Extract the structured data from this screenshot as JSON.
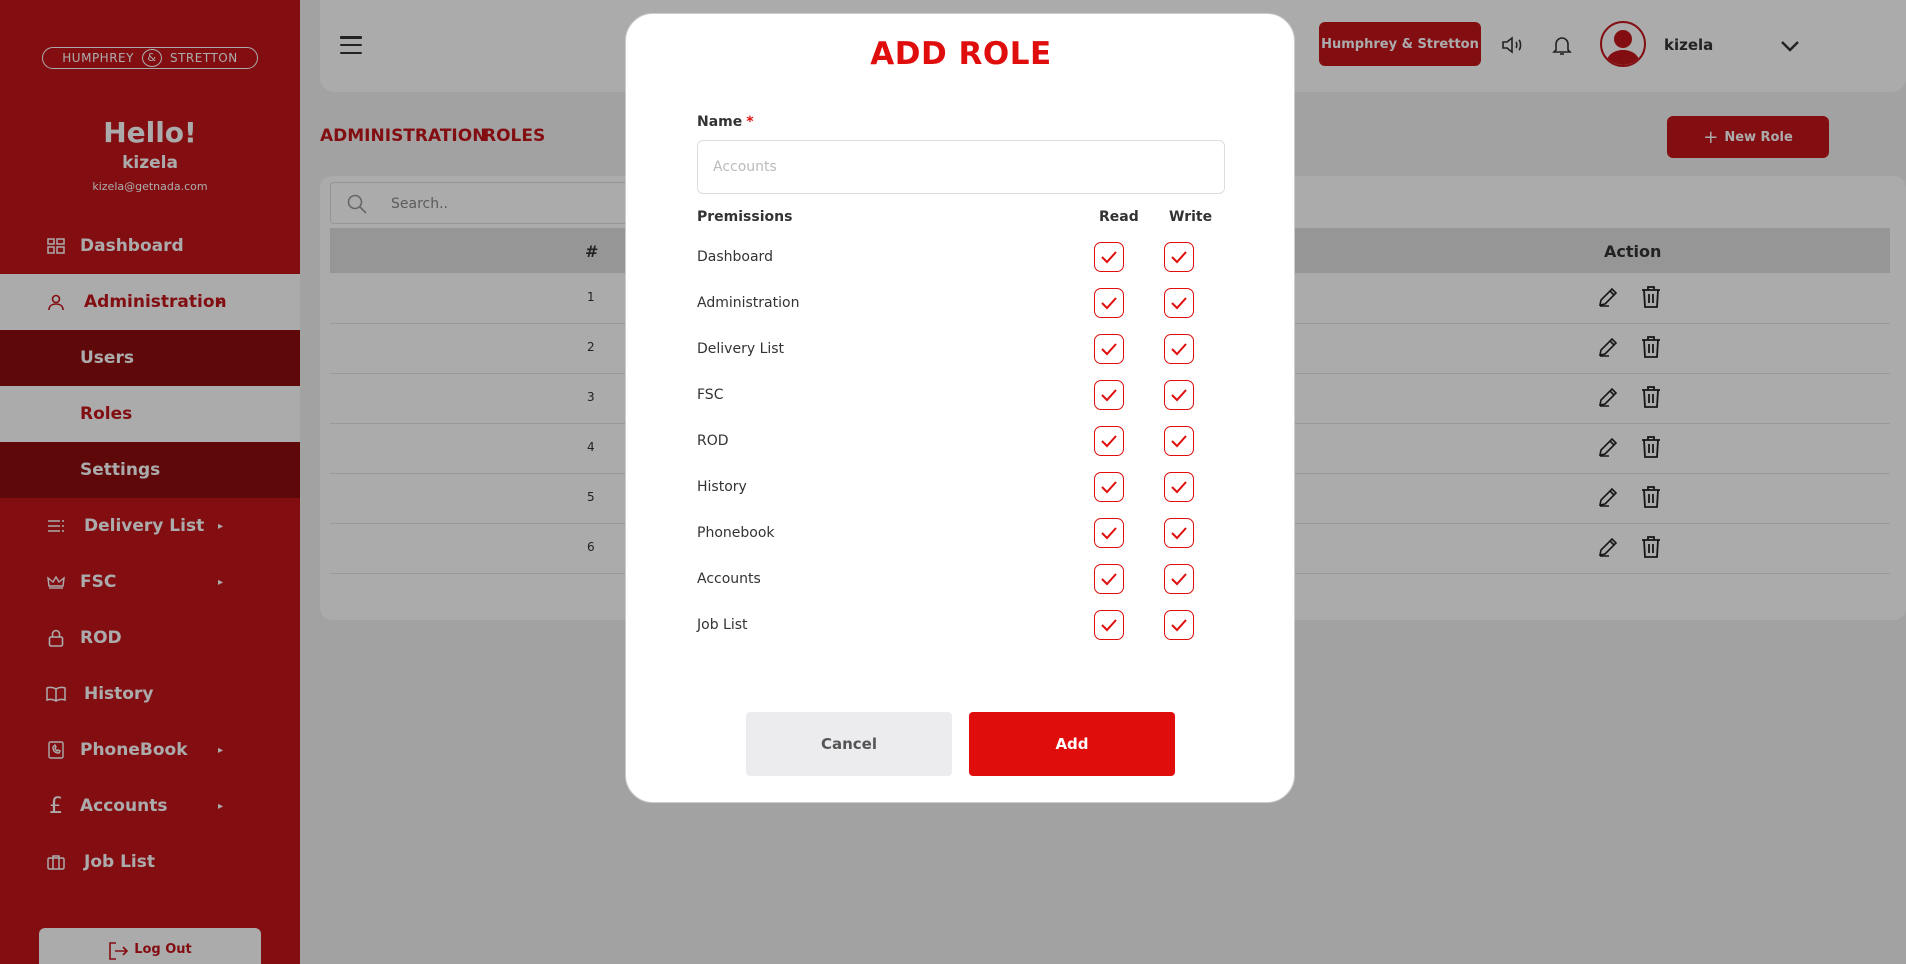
{
  "sidebar": {
    "logo": {
      "left": "HUMPHREY",
      "amp": "&",
      "right": "STRETTON"
    },
    "greeting": "Hello!",
    "username": "kizela",
    "email": "kizela@getnada.com",
    "items": [
      {
        "label": "Dashboard",
        "icon": "dashboard-icon"
      },
      {
        "label": "Administration",
        "icon": "user-icon",
        "arrow": "▸"
      },
      {
        "label": "Users"
      },
      {
        "label": "Roles"
      },
      {
        "label": "Settings"
      },
      {
        "label": "Delivery List",
        "icon": "list-icon",
        "arrow": "▸"
      },
      {
        "label": "FSC",
        "icon": "crown-icon",
        "arrow": "▸"
      },
      {
        "label": "ROD",
        "icon": "lock-icon"
      },
      {
        "label": "History",
        "icon": "book-icon"
      },
      {
        "label": "PhoneBook",
        "icon": "phonebook-icon",
        "arrow": "▸"
      },
      {
        "label": "Accounts",
        "icon": "pound-icon",
        "arrow": "▸"
      },
      {
        "label": "Job List",
        "icon": "briefcase-icon"
      }
    ],
    "logout": "Log Out"
  },
  "header": {
    "company": "Humphrey & Stretton",
    "user": "kizela"
  },
  "breadcrumb": {
    "first": "ADMINISTRATION",
    "second": "ROLES"
  },
  "new_role": "New Role",
  "table": {
    "search_placeholder": "Search..",
    "col_hash": "#",
    "col_action": "Action",
    "rows": [
      "1",
      "2",
      "3",
      "4",
      "5",
      "6"
    ]
  },
  "modal": {
    "title": "ADD ROLE",
    "name_label": "Name",
    "required_mark": "*",
    "name_placeholder": "Accounts",
    "permissions_header": "Premissions",
    "read_header": "Read",
    "write_header": "Write",
    "permissions": [
      {
        "label": "Dashboard",
        "read": true,
        "write": true
      },
      {
        "label": "Administration",
        "read": true,
        "write": true
      },
      {
        "label": "Delivery List",
        "read": true,
        "write": true
      },
      {
        "label": "FSC",
        "read": true,
        "write": true
      },
      {
        "label": "ROD",
        "read": true,
        "write": true
      },
      {
        "label": "History",
        "read": true,
        "write": true
      },
      {
        "label": "Phonebook",
        "read": true,
        "write": true
      },
      {
        "label": "Accounts",
        "read": true,
        "write": true
      },
      {
        "label": "Job List",
        "read": true,
        "write": true
      }
    ],
    "cancel": "Cancel",
    "add": "Add"
  },
  "colors": {
    "brand": "#c4161c",
    "accent": "#e00d0d",
    "overlay": "rgba(0,0,0,0.33)"
  }
}
